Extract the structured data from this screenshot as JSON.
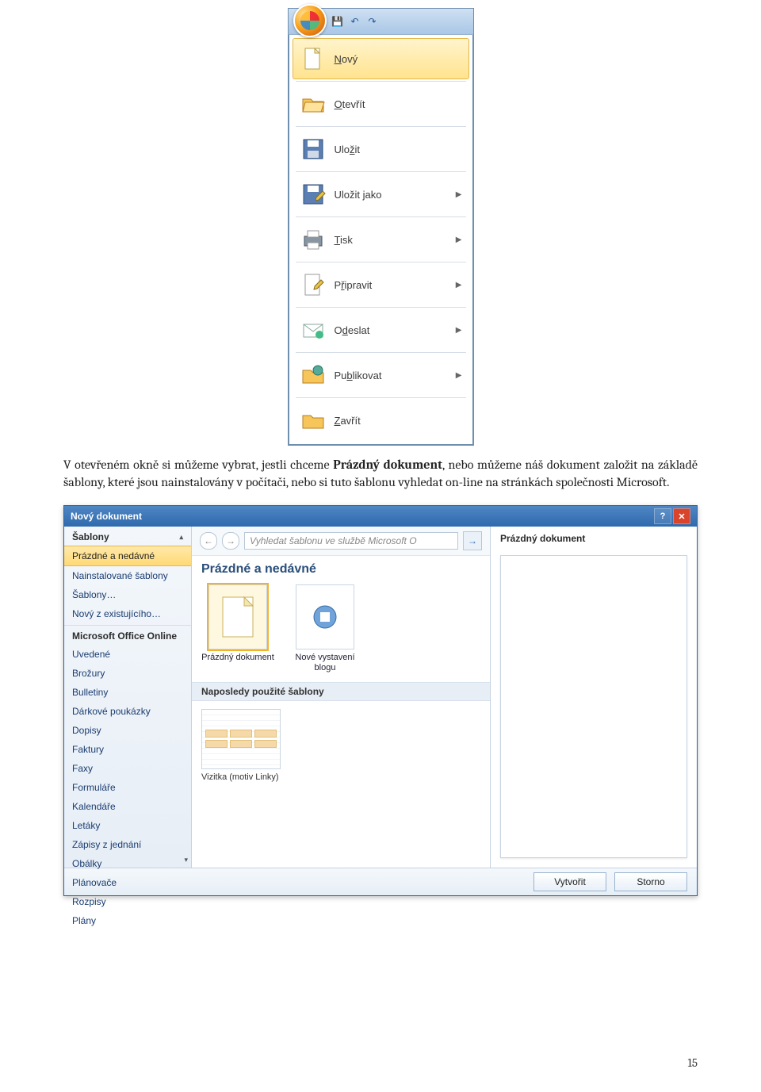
{
  "office_menu": {
    "items": [
      {
        "label": "Nový",
        "underline": "N",
        "arrow": false,
        "highlight": true,
        "icon": "new-doc-icon"
      },
      {
        "label": "Otevřít",
        "underline": "O",
        "arrow": false,
        "highlight": false,
        "icon": "open-icon"
      },
      {
        "label": "Uložit",
        "underline": "ž",
        "arrow": false,
        "highlight": false,
        "icon": "save-icon"
      },
      {
        "label": "Uložit jako",
        "underline": "j",
        "arrow": true,
        "highlight": false,
        "icon": "saveas-icon"
      },
      {
        "label": "Tisk",
        "underline": "T",
        "arrow": true,
        "highlight": false,
        "icon": "print-icon"
      },
      {
        "label": "Připravit",
        "underline": "ř",
        "arrow": true,
        "highlight": false,
        "icon": "prepare-icon"
      },
      {
        "label": "Odeslat",
        "underline": "d",
        "arrow": true,
        "highlight": false,
        "icon": "send-icon"
      },
      {
        "label": "Publikovat",
        "underline": "b",
        "arrow": true,
        "highlight": false,
        "icon": "publish-icon"
      },
      {
        "label": "Zavřít",
        "underline": "Z",
        "arrow": false,
        "highlight": false,
        "icon": "close-icon"
      }
    ]
  },
  "paragraph": {
    "pre": "V otevřeném okně si můžeme vybrat, jestli chceme ",
    "bold": "Prázdný dokument",
    "post": ", nebo můžeme náš dokument založit na základě šablony, které jsou nainstalovány v počítači, nebo si tuto šablonu vyhledat on-line na stránkách společnosti Microsoft."
  },
  "dialog": {
    "title": "Nový dokument",
    "sidebar": {
      "header": "Šablony",
      "items_top": [
        {
          "label": "Prázdné a nedávné",
          "selected": true
        },
        {
          "label": "Nainstalované šablony",
          "selected": false
        },
        {
          "label": "Šablony…",
          "selected": false
        },
        {
          "label": "Nový z existujícího…",
          "selected": false
        }
      ],
      "group_label": "Microsoft Office Online",
      "items_online": [
        "Uvedené",
        "Brožury",
        "Bulletiny",
        "Dárkové poukázky",
        "Dopisy",
        "Faktury",
        "Faxy",
        "Formuláře",
        "Kalendáře",
        "Letáky",
        "Zápisy z jednání",
        "Obálky",
        "Plánovače",
        "Rozpisy",
        "Plány"
      ]
    },
    "search_placeholder": "Vyhledat šablonu ve službě Microsoft O",
    "section_head": "Prázdné a nedávné",
    "thumbs": [
      {
        "label": "Prázdný dokument",
        "selected": true,
        "icon": "doc-icon"
      },
      {
        "label": "Nové vystavení blogu",
        "selected": false,
        "icon": "blog-icon"
      }
    ],
    "recent_head": "Naposledy použité šablony",
    "recent_label": "Vizitka (motiv Linky)",
    "preview_title": "Prázdný dokument",
    "footer": {
      "create": "Vytvořit",
      "cancel": "Storno"
    }
  },
  "page_number": "15"
}
